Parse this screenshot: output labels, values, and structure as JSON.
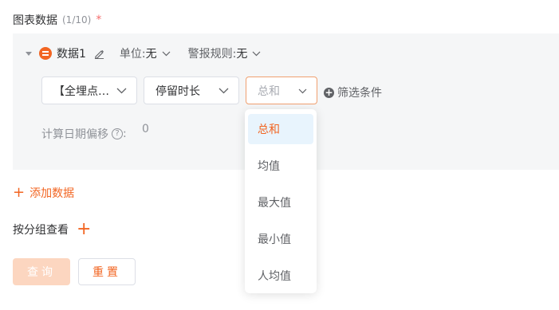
{
  "section": {
    "title": "图表数据",
    "count": "(1/10)",
    "required_mark": "*"
  },
  "series": {
    "name": "数据1",
    "unit_label": "单位:",
    "unit_value": "无",
    "rule_label": "警报规则:",
    "rule_value": "无"
  },
  "selects": {
    "point": "【全埋点…",
    "metric": "停留时长",
    "aggregate_placeholder": "总和"
  },
  "filter_label": "筛选条件",
  "offset": {
    "label": "计算日期偏移",
    "colon": ":",
    "value": "0"
  },
  "dropdown": {
    "options": [
      "总和",
      "均值",
      "最大值",
      "最小值",
      "人均值"
    ],
    "selected": "总和"
  },
  "add_data_label": "添加数据",
  "group_label": "按分组查看",
  "buttons": {
    "query": "查询",
    "reset": "重置"
  },
  "colors": {
    "accent": "#f26522",
    "panel_bg": "#f5f6f7",
    "selected_bg": "#e8f4fd"
  },
  "icons": {
    "caret": "caret-down-icon",
    "series": "series-icon",
    "edit": "pencil-icon",
    "chevron": "chevron-down-icon",
    "add_circle": "plus-circle-icon",
    "help": "question-circle-icon",
    "plus": "plus-icon"
  }
}
